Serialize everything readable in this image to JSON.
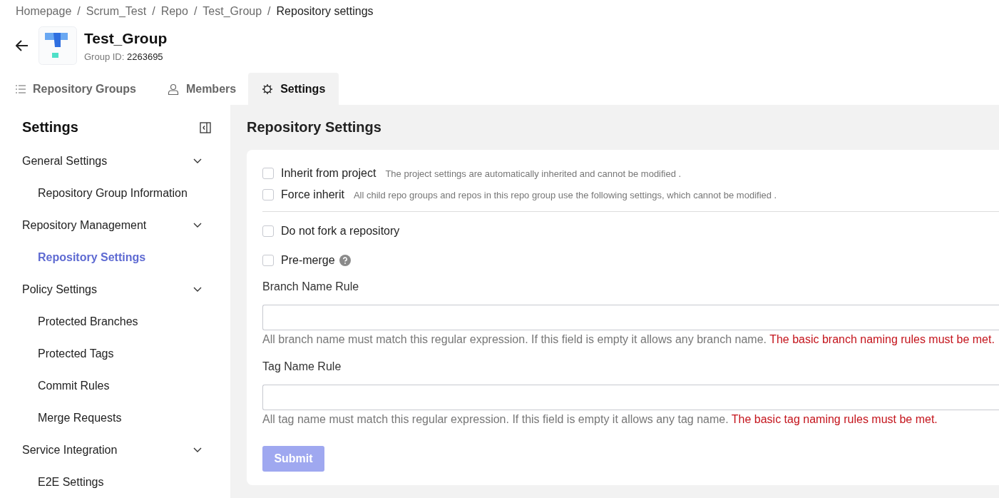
{
  "breadcrumbs": [
    {
      "label": "Homepage",
      "current": false
    },
    {
      "label": "Scrum_Test",
      "current": false
    },
    {
      "label": "Repo",
      "current": false
    },
    {
      "label": "Test_Group",
      "current": false
    },
    {
      "label": "Repository settings",
      "current": true
    }
  ],
  "breadcrumb_separator": "/",
  "header": {
    "title": "Test_Group",
    "id_label": "Group ID:",
    "id_value": "2263695"
  },
  "tabs": [
    {
      "label": "Repository Groups",
      "kind": "list",
      "selected": false
    },
    {
      "label": "Members",
      "kind": "person",
      "selected": false
    },
    {
      "label": "Settings",
      "kind": "gear",
      "selected": true
    }
  ],
  "sidebar": {
    "title": "Settings",
    "groups": [
      {
        "label": "General Settings",
        "expanded": true,
        "children": [
          {
            "label": "Repository Group Information",
            "selected": false
          }
        ]
      },
      {
        "label": "Repository Management",
        "expanded": true,
        "children": [
          {
            "label": "Repository Settings",
            "selected": true
          }
        ]
      },
      {
        "label": "Policy Settings",
        "expanded": true,
        "children": [
          {
            "label": "Protected Branches",
            "selected": false
          },
          {
            "label": "Protected Tags",
            "selected": false
          },
          {
            "label": "Commit Rules",
            "selected": false
          },
          {
            "label": "Merge Requests",
            "selected": false
          }
        ]
      },
      {
        "label": "Service Integration",
        "expanded": true,
        "children": [
          {
            "label": "E2E Settings",
            "selected": false
          }
        ]
      }
    ]
  },
  "main": {
    "title": "Repository Settings",
    "inherit_options": [
      {
        "label": "Inherit from project",
        "description": "The project settings are automatically inherited and cannot be modified .",
        "checked": false
      },
      {
        "label": "Force inherit",
        "description": "All child repo groups and repos in this repo group use the following settings, which cannot be modified .",
        "checked": false
      }
    ],
    "options": [
      {
        "label": "Do not fork a repository",
        "checked": false,
        "kind": "plain"
      },
      {
        "label": "Pre-merge",
        "checked": false,
        "kind": "with_help"
      }
    ],
    "rules": [
      {
        "label": "Branch Name Rule",
        "hint": "All branch name must match this regular expression. If this field is empty it allows any branch name.",
        "warning": "The basic branch naming rules must be met."
      },
      {
        "label": "Tag Name Rule",
        "hint": "All tag name must match this regular expression. If this field is empty it allows any tag name.",
        "warning": "The basic tag naming rules must be met."
      }
    ],
    "submit": {
      "label": "Submit",
      "disabled": true
    }
  }
}
